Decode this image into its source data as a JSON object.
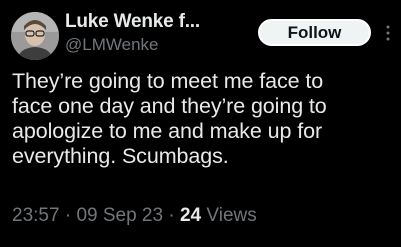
{
  "tweet": {
    "author": {
      "display_name": "Luke Wenke f...",
      "handle": "@LMWenke"
    },
    "follow_label": "Follow",
    "more_icon": "more-vertical-icon",
    "text_lines": [
      "They’re going to meet me face to",
      "face one day and they’re going to",
      "apologize to me and make up for",
      "everything.  Scumbags."
    ],
    "meta": {
      "time": "23:57",
      "separator": " · ",
      "date": "09 Sep 23",
      "views_count": "24",
      "views_label": "Views"
    }
  },
  "colors": {
    "background": "#000000",
    "primary_text": "#e7e9ea",
    "secondary_text": "#71767b",
    "button_bg": "#eff3f4",
    "button_text": "#0f1419"
  }
}
